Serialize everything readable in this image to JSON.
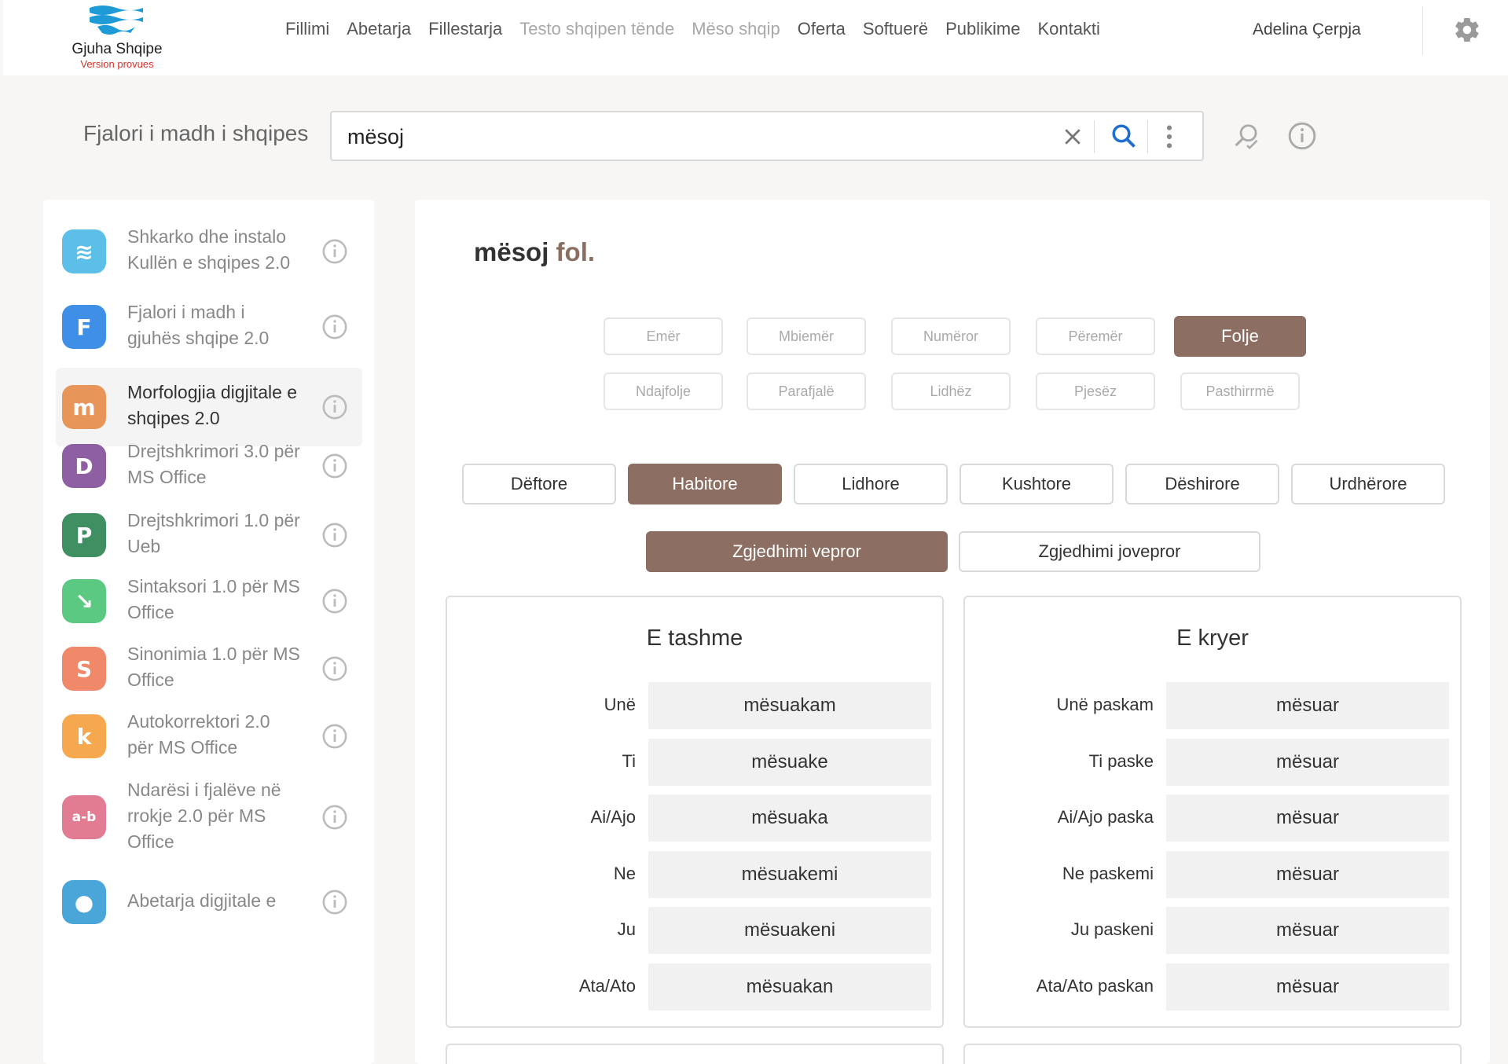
{
  "brand": {
    "title": "Gjuha Shqipe",
    "subtitle": "Version provues"
  },
  "nav": [
    {
      "label": "Fillimi",
      "muted": false
    },
    {
      "label": "Abetarja",
      "muted": false
    },
    {
      "label": "Fillestarja",
      "muted": false
    },
    {
      "label": "Testo shqipen tënde",
      "muted": true
    },
    {
      "label": "Mëso shqip",
      "muted": true
    },
    {
      "label": "Oferta",
      "muted": false
    },
    {
      "label": "Softuerë",
      "muted": false
    },
    {
      "label": "Publikime",
      "muted": false
    },
    {
      "label": "Kontakti",
      "muted": false
    }
  ],
  "user": {
    "name": "Adelina Çerpja"
  },
  "search": {
    "title": "Fjalori i madh i shqipes",
    "value": "mësoj"
  },
  "sidebar": {
    "items": [
      {
        "label": "Shkarko dhe instalo Kullën e shqipes 2.0",
        "icon": "waves-icon",
        "color": "#5bbfe8"
      },
      {
        "label": "Fjalori i madh i gjuhës shqipe 2.0",
        "icon": "f-letter-icon",
        "color": "#3f8fe6"
      },
      {
        "label": "Morfologjia digjitale e shqipes 2.0",
        "icon": "m-letter-icon",
        "color": "#e8955a"
      },
      {
        "label": "Drejtshkrimori 3.0 për MS Office",
        "icon": "d-letter-icon",
        "color": "#8e5fa3"
      },
      {
        "label": "Drejtshkrimori 1.0 për Ueb",
        "icon": "p-letter-icon",
        "color": "#3f8f63"
      },
      {
        "label": "Sintaksori 1.0 për MS Office",
        "icon": "syntax-icon",
        "color": "#5bc981"
      },
      {
        "label": "Sinonimia 1.0 për MS Office",
        "icon": "s-letter-icon",
        "color": "#f0886a"
      },
      {
        "label": "Autokorrektori 2.0 për MS Office",
        "icon": "k-letter-icon",
        "color": "#f5a84e"
      },
      {
        "label": "Ndarësi i fjalëve në rrokje 2.0 për MS Office",
        "icon": "ab-icon",
        "color": "#e27c93"
      },
      {
        "label": "Abetarja digjitale e",
        "icon": "bird-icon",
        "color": "#4aa6d9"
      }
    ]
  },
  "entry": {
    "word": "mësoj",
    "pos": "fol."
  },
  "pos_buttons": [
    "Emër",
    "Mbiemër",
    "Numëror",
    "Përemër",
    "Folje",
    "Ndajfolje",
    "Parafjalë",
    "Lidhëz",
    "Pjesëz",
    "Pasthirrmë"
  ],
  "pos_selected": "Folje",
  "moods": [
    "Dëftore",
    "Habitore",
    "Lidhore",
    "Kushtore",
    "Dëshirore",
    "Urdhërore"
  ],
  "mood_selected": "Habitore",
  "voices": [
    "Zgjedhimi vepror",
    "Zgjedhimi jovepror"
  ],
  "voice_selected": "Zgjedhimi vepror",
  "tenses": [
    {
      "title": "E tashme",
      "rows": [
        {
          "person": "Unë",
          "form": "mësuakam"
        },
        {
          "person": "Ti",
          "form": "mësuake"
        },
        {
          "person": "Ai/Ajo",
          "form": "mësuaka"
        },
        {
          "person": "Ne",
          "form": "mësuakemi"
        },
        {
          "person": "Ju",
          "form": "mësuakeni"
        },
        {
          "person": "Ata/Ato",
          "form": "mësuakan"
        }
      ]
    },
    {
      "title": "E kryer",
      "rows": [
        {
          "person": "Unë paskam",
          "form": "mësuar"
        },
        {
          "person": "Ti paske",
          "form": "mësuar"
        },
        {
          "person": "Ai/Ajo paska",
          "form": "mësuar"
        },
        {
          "person": "Ne paskemi",
          "form": "mësuar"
        },
        {
          "person": "Ju paskeni",
          "form": "mësuar"
        },
        {
          "person": "Ata/Ato paskan",
          "form": "mësuar"
        }
      ]
    }
  ],
  "colors": {
    "accent": "#8c6e62",
    "brand_blue": "#1e9ad6",
    "brand_red": "#d4312a"
  }
}
